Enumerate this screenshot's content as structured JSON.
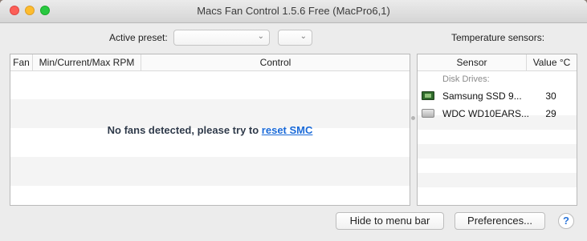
{
  "window": {
    "title": "Macs Fan Control 1.5.6 Free (MacPro6,1)"
  },
  "preset": {
    "label": "Active preset:",
    "value": "",
    "secondary_value": ""
  },
  "fans_table": {
    "columns": [
      "Fan",
      "Min/Current/Max RPM",
      "Control"
    ],
    "empty_message": "No fans detected, please try to ",
    "empty_link": "reset SMC"
  },
  "sensors": {
    "label": "Temperature sensors:",
    "columns": [
      "Sensor",
      "Value °C"
    ],
    "group": "Disk Drives:",
    "rows": [
      {
        "icon": "ssd-icon",
        "name": "Samsung SSD 9...",
        "value": "30"
      },
      {
        "icon": "hard-drive-icon",
        "name": "WDC WD10EARS...",
        "value": "29"
      }
    ]
  },
  "buttons": {
    "hide_to_menu_bar": "Hide to menu bar",
    "preferences": "Preferences...",
    "help": "?"
  },
  "colors": {
    "close": "#fc5f57",
    "minimize": "#fdbc2e",
    "maximize": "#28c840",
    "link": "#1a6ad8"
  }
}
